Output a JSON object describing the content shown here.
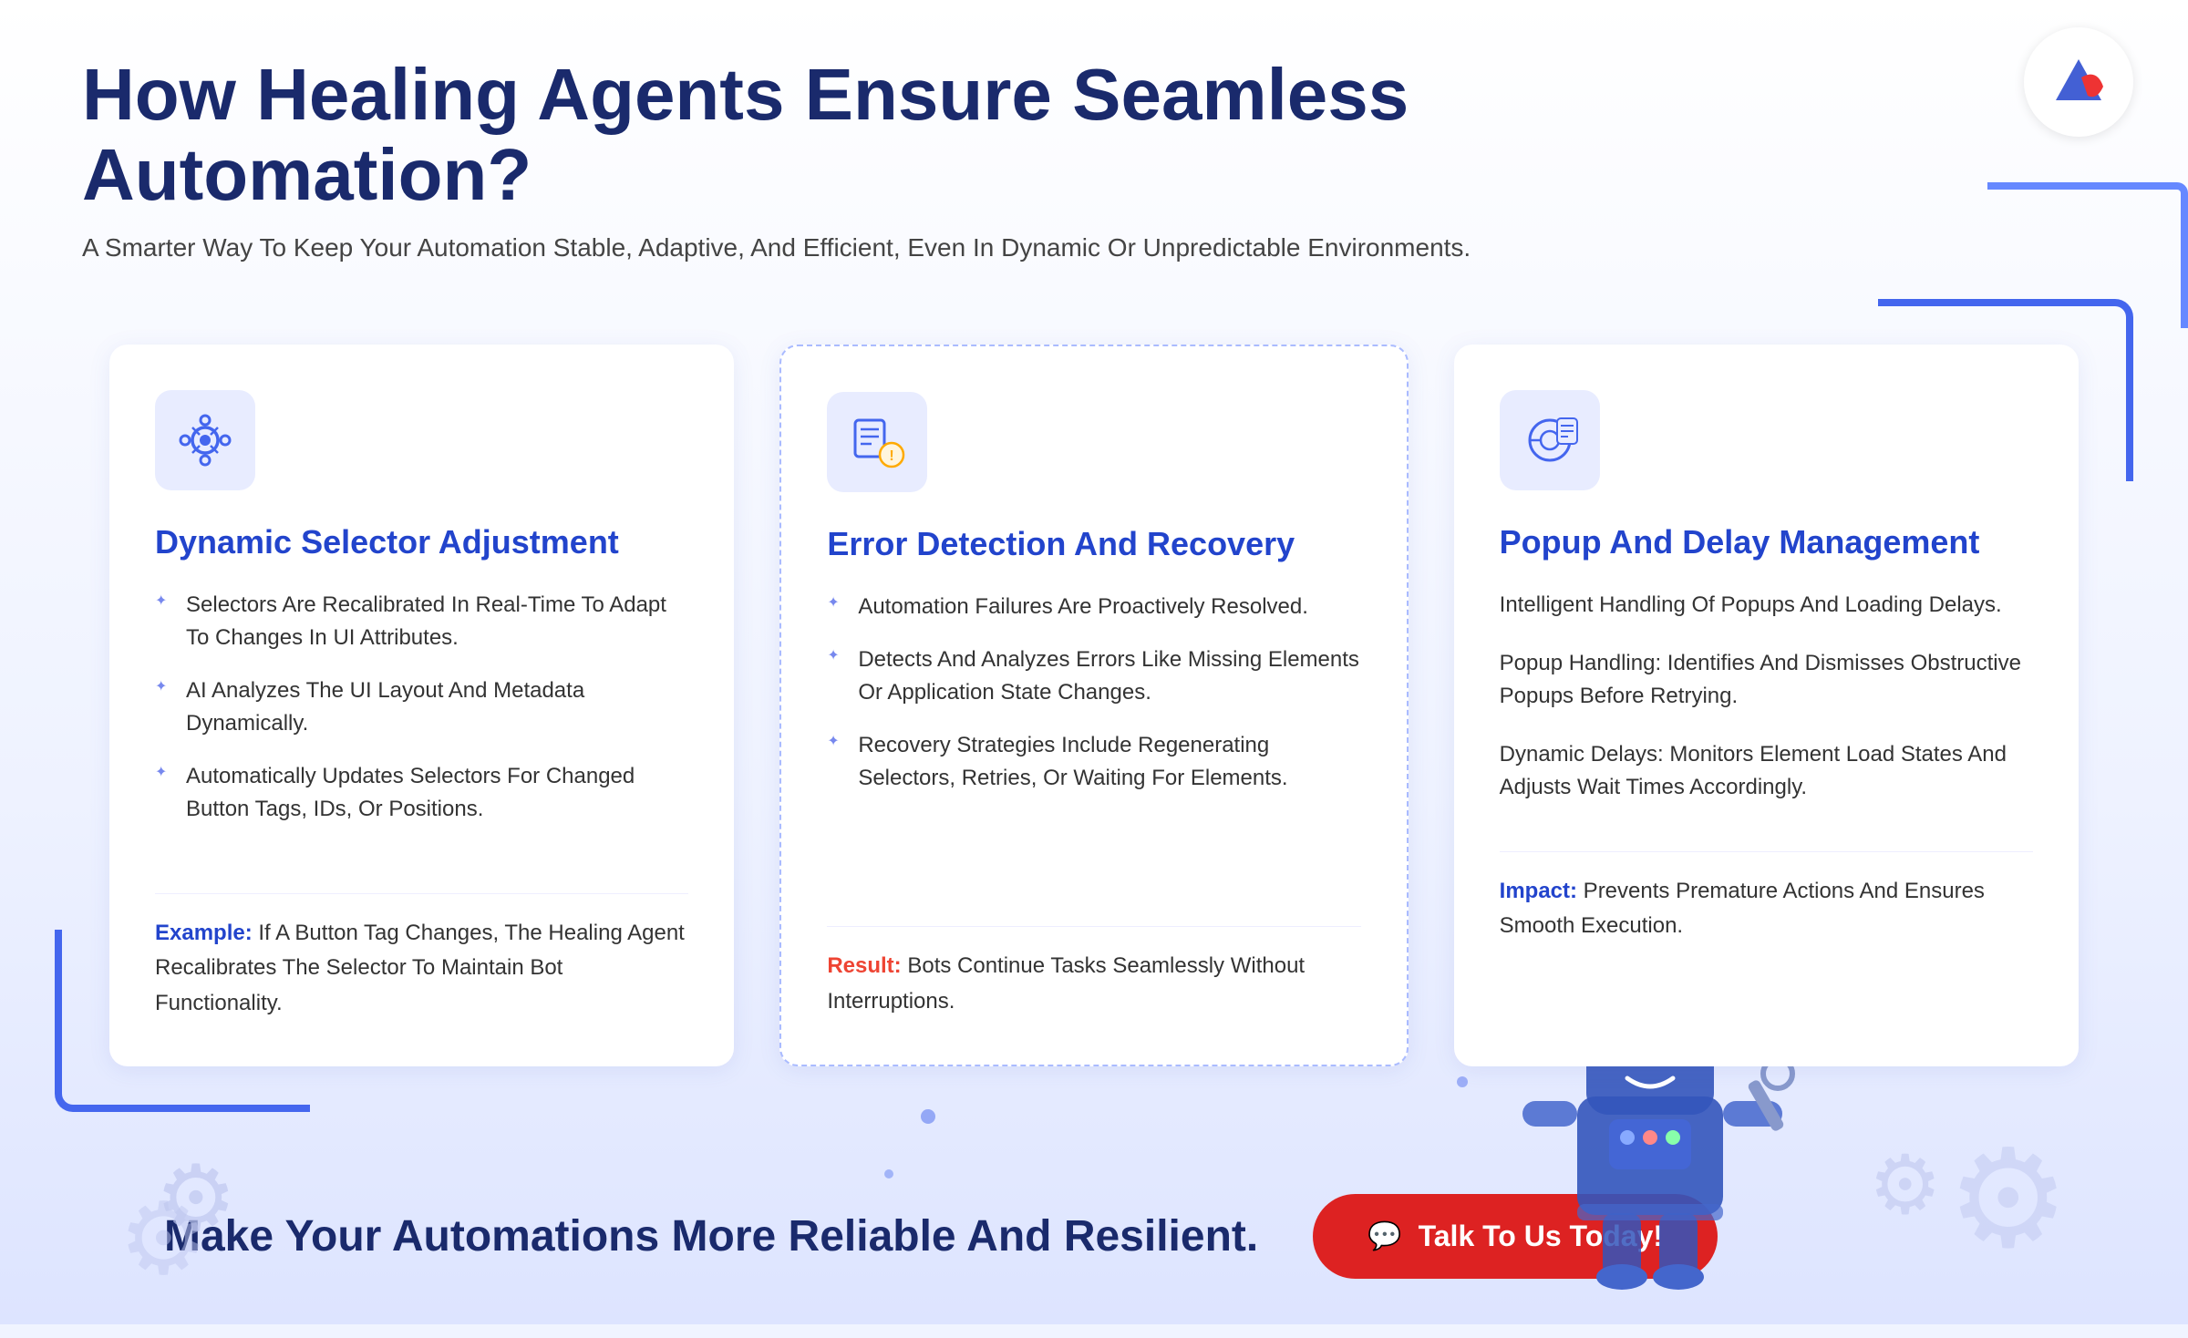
{
  "header": {
    "title": "How Healing Agents Ensure Seamless Automation?",
    "subtitle": "A Smarter Way To Keep Your Automation Stable, Adaptive, And Efficient, Even In Dynamic Or Unpredictable Environments."
  },
  "cards": [
    {
      "id": "dynamic-selector",
      "title": "Dynamic Selector Adjustment",
      "icon": "selector-icon",
      "bullets": [
        "Selectors Are Recalibrated In Real-Time To Adapt To Changes In UI Attributes.",
        "AI Analyzes The UI Layout And Metadata Dynamically.",
        "Automatically Updates Selectors For Changed Button Tags, IDs, Or Positions."
      ],
      "footer_label": "Example:",
      "footer_label_type": "blue",
      "footer_text": " If A Button Tag Changes, The Healing Agent Recalibrates The Selector To Maintain Bot Functionality."
    },
    {
      "id": "error-detection",
      "title": "Error Detection And Recovery",
      "icon": "error-icon",
      "bullets": [
        "Automation Failures Are Proactively Resolved.",
        "Detects And Analyzes Errors Like Missing Elements Or Application State Changes.",
        "Recovery Strategies Include Regenerating Selectors, Retries, Or Waiting For Elements."
      ],
      "footer_label": "Result:",
      "footer_label_type": "red",
      "footer_text": " Bots Continue Tasks Seamlessly Without Interruptions."
    },
    {
      "id": "popup-delay",
      "title": "Popup And Delay Management",
      "icon": "popup-icon",
      "intro_text": "Intelligent Handling Of Popups And Loading Delays.",
      "popup_handling_label": "Popup Handling:",
      "popup_handling_text": " Identifies And Dismisses Obstructive Popups Before Retrying.",
      "dynamic_delays_label": "Dynamic Delays:",
      "dynamic_delays_text": " Monitors Element Load States And Adjusts Wait Times Accordingly.",
      "footer_label": "Impact:",
      "footer_label_type": "blue",
      "footer_text": " Prevents Premature Actions And Ensures Smooth Execution."
    }
  ],
  "cta": {
    "text": "Make Your Automations More Reliable And Resilient.",
    "button_label": "Talk To Us Today!",
    "button_icon": "💬"
  },
  "logo": {
    "symbol": "🔷"
  }
}
